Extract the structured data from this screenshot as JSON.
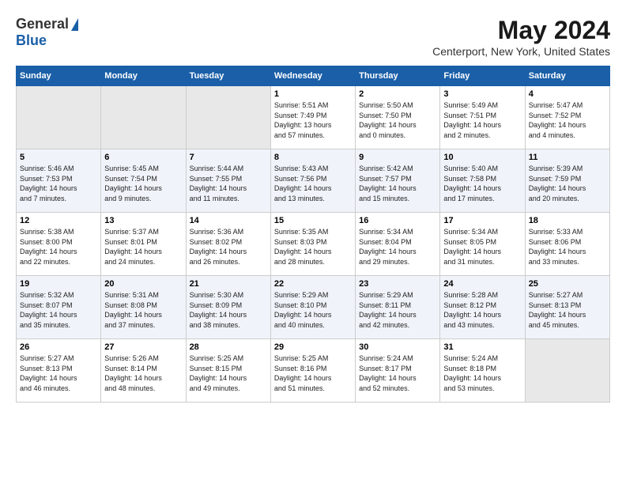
{
  "header": {
    "logo_general": "General",
    "logo_blue": "Blue",
    "month_year": "May 2024",
    "location": "Centerport, New York, United States"
  },
  "days_of_week": [
    "Sunday",
    "Monday",
    "Tuesday",
    "Wednesday",
    "Thursday",
    "Friday",
    "Saturday"
  ],
  "weeks": [
    [
      {
        "day": "",
        "info": ""
      },
      {
        "day": "",
        "info": ""
      },
      {
        "day": "",
        "info": ""
      },
      {
        "day": "1",
        "info": "Sunrise: 5:51 AM\nSunset: 7:49 PM\nDaylight: 13 hours\nand 57 minutes."
      },
      {
        "day": "2",
        "info": "Sunrise: 5:50 AM\nSunset: 7:50 PM\nDaylight: 14 hours\nand 0 minutes."
      },
      {
        "day": "3",
        "info": "Sunrise: 5:49 AM\nSunset: 7:51 PM\nDaylight: 14 hours\nand 2 minutes."
      },
      {
        "day": "4",
        "info": "Sunrise: 5:47 AM\nSunset: 7:52 PM\nDaylight: 14 hours\nand 4 minutes."
      }
    ],
    [
      {
        "day": "5",
        "info": "Sunrise: 5:46 AM\nSunset: 7:53 PM\nDaylight: 14 hours\nand 7 minutes."
      },
      {
        "day": "6",
        "info": "Sunrise: 5:45 AM\nSunset: 7:54 PM\nDaylight: 14 hours\nand 9 minutes."
      },
      {
        "day": "7",
        "info": "Sunrise: 5:44 AM\nSunset: 7:55 PM\nDaylight: 14 hours\nand 11 minutes."
      },
      {
        "day": "8",
        "info": "Sunrise: 5:43 AM\nSunset: 7:56 PM\nDaylight: 14 hours\nand 13 minutes."
      },
      {
        "day": "9",
        "info": "Sunrise: 5:42 AM\nSunset: 7:57 PM\nDaylight: 14 hours\nand 15 minutes."
      },
      {
        "day": "10",
        "info": "Sunrise: 5:40 AM\nSunset: 7:58 PM\nDaylight: 14 hours\nand 17 minutes."
      },
      {
        "day": "11",
        "info": "Sunrise: 5:39 AM\nSunset: 7:59 PM\nDaylight: 14 hours\nand 20 minutes."
      }
    ],
    [
      {
        "day": "12",
        "info": "Sunrise: 5:38 AM\nSunset: 8:00 PM\nDaylight: 14 hours\nand 22 minutes."
      },
      {
        "day": "13",
        "info": "Sunrise: 5:37 AM\nSunset: 8:01 PM\nDaylight: 14 hours\nand 24 minutes."
      },
      {
        "day": "14",
        "info": "Sunrise: 5:36 AM\nSunset: 8:02 PM\nDaylight: 14 hours\nand 26 minutes."
      },
      {
        "day": "15",
        "info": "Sunrise: 5:35 AM\nSunset: 8:03 PM\nDaylight: 14 hours\nand 28 minutes."
      },
      {
        "day": "16",
        "info": "Sunrise: 5:34 AM\nSunset: 8:04 PM\nDaylight: 14 hours\nand 29 minutes."
      },
      {
        "day": "17",
        "info": "Sunrise: 5:34 AM\nSunset: 8:05 PM\nDaylight: 14 hours\nand 31 minutes."
      },
      {
        "day": "18",
        "info": "Sunrise: 5:33 AM\nSunset: 8:06 PM\nDaylight: 14 hours\nand 33 minutes."
      }
    ],
    [
      {
        "day": "19",
        "info": "Sunrise: 5:32 AM\nSunset: 8:07 PM\nDaylight: 14 hours\nand 35 minutes."
      },
      {
        "day": "20",
        "info": "Sunrise: 5:31 AM\nSunset: 8:08 PM\nDaylight: 14 hours\nand 37 minutes."
      },
      {
        "day": "21",
        "info": "Sunrise: 5:30 AM\nSunset: 8:09 PM\nDaylight: 14 hours\nand 38 minutes."
      },
      {
        "day": "22",
        "info": "Sunrise: 5:29 AM\nSunset: 8:10 PM\nDaylight: 14 hours\nand 40 minutes."
      },
      {
        "day": "23",
        "info": "Sunrise: 5:29 AM\nSunset: 8:11 PM\nDaylight: 14 hours\nand 42 minutes."
      },
      {
        "day": "24",
        "info": "Sunrise: 5:28 AM\nSunset: 8:12 PM\nDaylight: 14 hours\nand 43 minutes."
      },
      {
        "day": "25",
        "info": "Sunrise: 5:27 AM\nSunset: 8:13 PM\nDaylight: 14 hours\nand 45 minutes."
      }
    ],
    [
      {
        "day": "26",
        "info": "Sunrise: 5:27 AM\nSunset: 8:13 PM\nDaylight: 14 hours\nand 46 minutes."
      },
      {
        "day": "27",
        "info": "Sunrise: 5:26 AM\nSunset: 8:14 PM\nDaylight: 14 hours\nand 48 minutes."
      },
      {
        "day": "28",
        "info": "Sunrise: 5:25 AM\nSunset: 8:15 PM\nDaylight: 14 hours\nand 49 minutes."
      },
      {
        "day": "29",
        "info": "Sunrise: 5:25 AM\nSunset: 8:16 PM\nDaylight: 14 hours\nand 51 minutes."
      },
      {
        "day": "30",
        "info": "Sunrise: 5:24 AM\nSunset: 8:17 PM\nDaylight: 14 hours\nand 52 minutes."
      },
      {
        "day": "31",
        "info": "Sunrise: 5:24 AM\nSunset: 8:18 PM\nDaylight: 14 hours\nand 53 minutes."
      },
      {
        "day": "",
        "info": ""
      }
    ]
  ]
}
